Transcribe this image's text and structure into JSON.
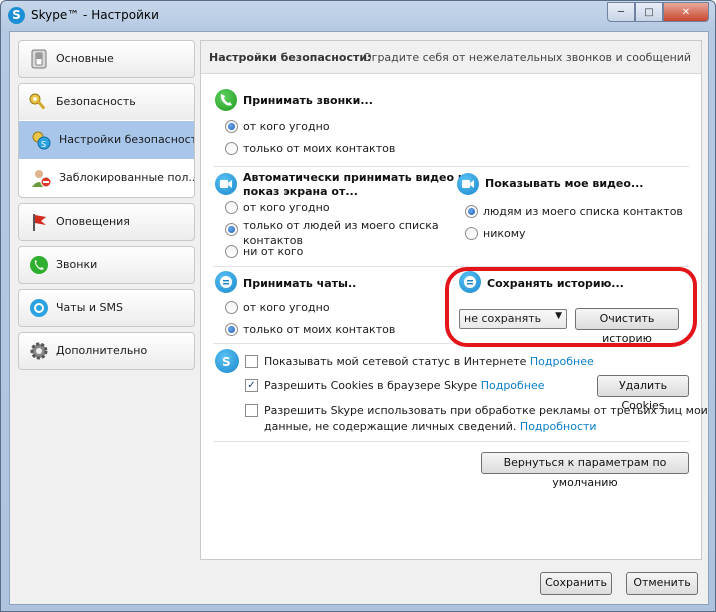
{
  "window": {
    "title": "Skype™ - Настройки"
  },
  "sidebar": {
    "items": [
      {
        "label": "Основные"
      },
      {
        "label": "Безопасность"
      },
      {
        "label": "Настройки безопасности"
      },
      {
        "label": "Заблокированные пол..."
      },
      {
        "label": "Оповещения"
      },
      {
        "label": "Звонки"
      },
      {
        "label": "Чаты и SMS"
      },
      {
        "label": "Дополнительно"
      }
    ]
  },
  "panel": {
    "title": "Настройки безопасности:",
    "subtitle": "Оградите себя от нежелательных звонков и сообщений",
    "calls": {
      "title": "Принимать звонки...",
      "opt1": "от кого угодно",
      "opt2": "только от моих контактов",
      "selected": "opt1"
    },
    "video_auto": {
      "title_line1": "Автоматически принимать видео и",
      "title_line2": "показ экрана от...",
      "opt1": "от кого угодно",
      "opt2_line1": "только от людей из моего списка",
      "opt2_line2": "контактов",
      "opt3": "ни от кого",
      "selected": "opt2"
    },
    "show_video": {
      "title": "Показывать мое видео...",
      "opt1": "людям из моего списка контактов",
      "opt2": "никому",
      "selected": "opt1"
    },
    "chats": {
      "title": "Принимать чаты..",
      "opt1": "от кого угодно",
      "opt2": "только от моих контактов",
      "selected": "opt2"
    },
    "history": {
      "title": "Сохранять историю...",
      "select_value": "не сохранять",
      "clear_button": "Очистить историю"
    },
    "privacy": {
      "status_label": "Показывать мой сетевой статус в Интернете",
      "status_link": "Подробнее",
      "status_checked": false,
      "cookies_label": "Разрешить Cookies в браузере Skype",
      "cookies_link": "Подробнее",
      "cookies_checked": true,
      "delete_cookies_button": "Удалить Cookies",
      "ads_line1": "Разрешить Skype использовать при обработке рекламы от третьих лиц мои",
      "ads_line2": "данные, не содержащие личных сведений.",
      "ads_link": "Подробности",
      "ads_checked": false
    },
    "defaults_button": "Вернуться к параметрам по умолчанию"
  },
  "footer": {
    "save": "Сохранить",
    "cancel": "Отменить"
  },
  "colors": {
    "accent_link": "#0a7fc9",
    "active_item": "#a7c6ea",
    "highlight_ring": "#e3151b"
  }
}
